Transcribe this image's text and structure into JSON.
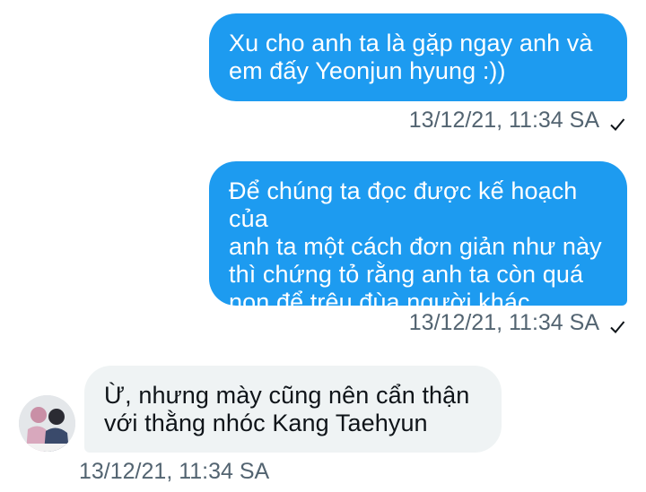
{
  "conversation": {
    "messages": [
      {
        "direction": "outgoing",
        "text": "Xu cho anh ta là gặp ngay anh và\nem đấy Yeonjun hyung :))",
        "timestamp": "13/12/21, 11:34 SA",
        "status_icon": "check-icon"
      },
      {
        "direction": "outgoing",
        "text": "Để chúng ta đọc được kế hoạch của\nanh ta một cách đơn giản như này\nthì chứng tỏ rằng anh ta còn quá\nnon để trêu đùa người khác",
        "timestamp": "13/12/21, 11:34 SA",
        "status_icon": "check-icon"
      },
      {
        "direction": "incoming",
        "text": "Ừ, nhưng mày cũng nên cẩn thận\nvới thằng nhóc Kang Taehyun",
        "timestamp": "13/12/21, 11:34 SA",
        "avatar_icon": "avatar"
      }
    ]
  },
  "colors": {
    "outgoing_bubble": "#1d9bf0",
    "incoming_bubble": "#eff3f4",
    "meta_text": "#536471"
  }
}
